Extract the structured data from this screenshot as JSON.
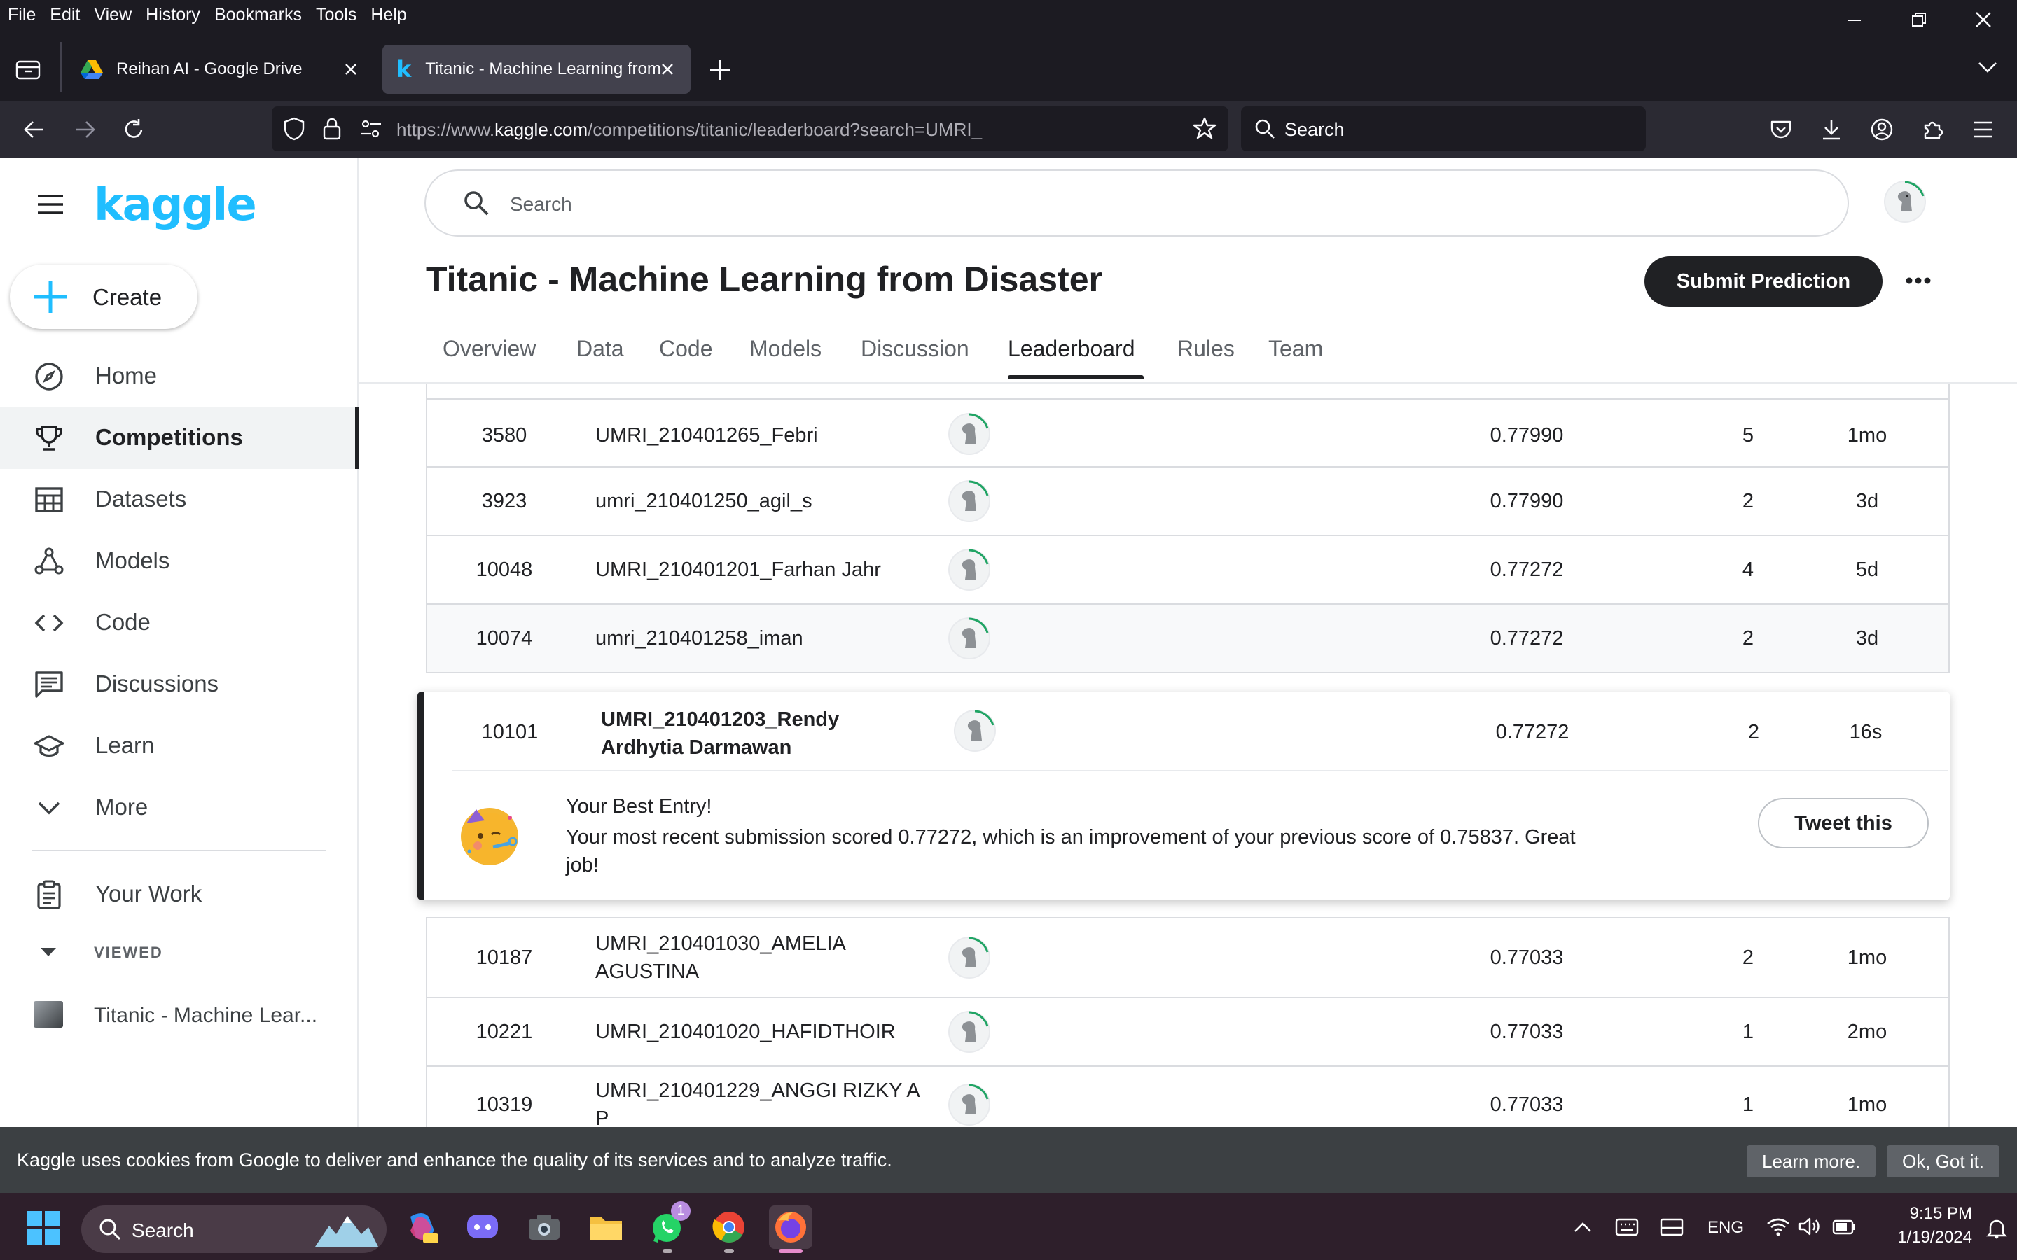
{
  "browser": {
    "menu": [
      "File",
      "Edit",
      "View",
      "History",
      "Bookmarks",
      "Tools",
      "Help"
    ],
    "tabs": [
      {
        "title": "Reihan AI - Google Drive"
      },
      {
        "title": "Titanic - Machine Learning from Disaster"
      }
    ],
    "url_prefix": "https://www.",
    "url_domain": "kaggle.com",
    "url_path": "/competitions/titanic/leaderboard?search=UMRI_",
    "search_placeholder": "Search"
  },
  "sidebar": {
    "logo": "kaggle",
    "create_label": "Create",
    "items": [
      {
        "label": "Home",
        "icon": "compass-icon"
      },
      {
        "label": "Competitions",
        "icon": "trophy-icon"
      },
      {
        "label": "Datasets",
        "icon": "table-icon"
      },
      {
        "label": "Models",
        "icon": "models-icon"
      },
      {
        "label": "Code",
        "icon": "code-icon"
      },
      {
        "label": "Discussions",
        "icon": "discussion-icon"
      },
      {
        "label": "Learn",
        "icon": "graduation-cap-icon"
      },
      {
        "label": "More",
        "icon": "chevron-down-icon"
      }
    ],
    "your_work": "Your Work",
    "viewed_label": "VIEWED",
    "viewed_item": "Titanic - Machine Lear..."
  },
  "main": {
    "search_placeholder": "Search",
    "title": "Titanic - Machine Learning from Disaster",
    "submit_label": "Submit Prediction",
    "tabs": [
      "Overview",
      "Data",
      "Code",
      "Models",
      "Discussion",
      "Leaderboard",
      "Rules",
      "Team"
    ],
    "active_tab": "Leaderboard"
  },
  "leaderboard": {
    "rows_above": [
      {
        "rank": "3580",
        "team": "UMRI_210401265_Febri",
        "score": "0.77990",
        "entries": "5",
        "last": "1mo"
      },
      {
        "rank": "3923",
        "team": "umri_210401250_agil_s",
        "score": "0.77990",
        "entries": "2",
        "last": "3d"
      },
      {
        "rank": "10048",
        "team": "UMRI_210401201_Farhan Jahr",
        "score": "0.77272",
        "entries": "4",
        "last": "5d"
      },
      {
        "rank": "10074",
        "team": "umri_210401258_iman",
        "score": "0.77272",
        "entries": "2",
        "last": "3d"
      }
    ],
    "own": {
      "rank": "10101",
      "team": "UMRI_210401203_Rendy Ardhytia Darmawan",
      "score": "0.77272",
      "entries": "2",
      "last": "16s"
    },
    "best_entry": {
      "title": "Your Best Entry!",
      "message": "Your most recent submission scored 0.77272, which is an improvement of your previous score of 0.75837. Great job!",
      "tweet_label": "Tweet this"
    },
    "rows_below": [
      {
        "rank": "10187",
        "team": "UMRI_210401030_AMELIA AGUSTINA",
        "score": "0.77033",
        "entries": "2",
        "last": "1mo"
      },
      {
        "rank": "10221",
        "team": "UMRI_210401020_HAFIDTHOIR",
        "score": "0.77033",
        "entries": "1",
        "last": "2mo"
      },
      {
        "rank": "10319",
        "team": "UMRI_210401229_ANGGI RIZKY A P",
        "score": "0.77033",
        "entries": "1",
        "last": "1mo"
      }
    ]
  },
  "cookie": {
    "message": "Kaggle uses cookies from Google to deliver and enhance the quality of its services and to analyze traffic.",
    "learn_more": "Learn more.",
    "ok": "Ok, Got it."
  },
  "taskbar": {
    "search_label": "Search",
    "whatsapp_badge": "1",
    "language": "ENG",
    "time": "9:15 PM",
    "date": "1/19/2024"
  },
  "colors": {
    "kaggle_blue": "#20beff",
    "firefox_dark": "#1c1b22",
    "firefox_nav": "#2b2a33",
    "taskbar": "#2e1f2b"
  }
}
